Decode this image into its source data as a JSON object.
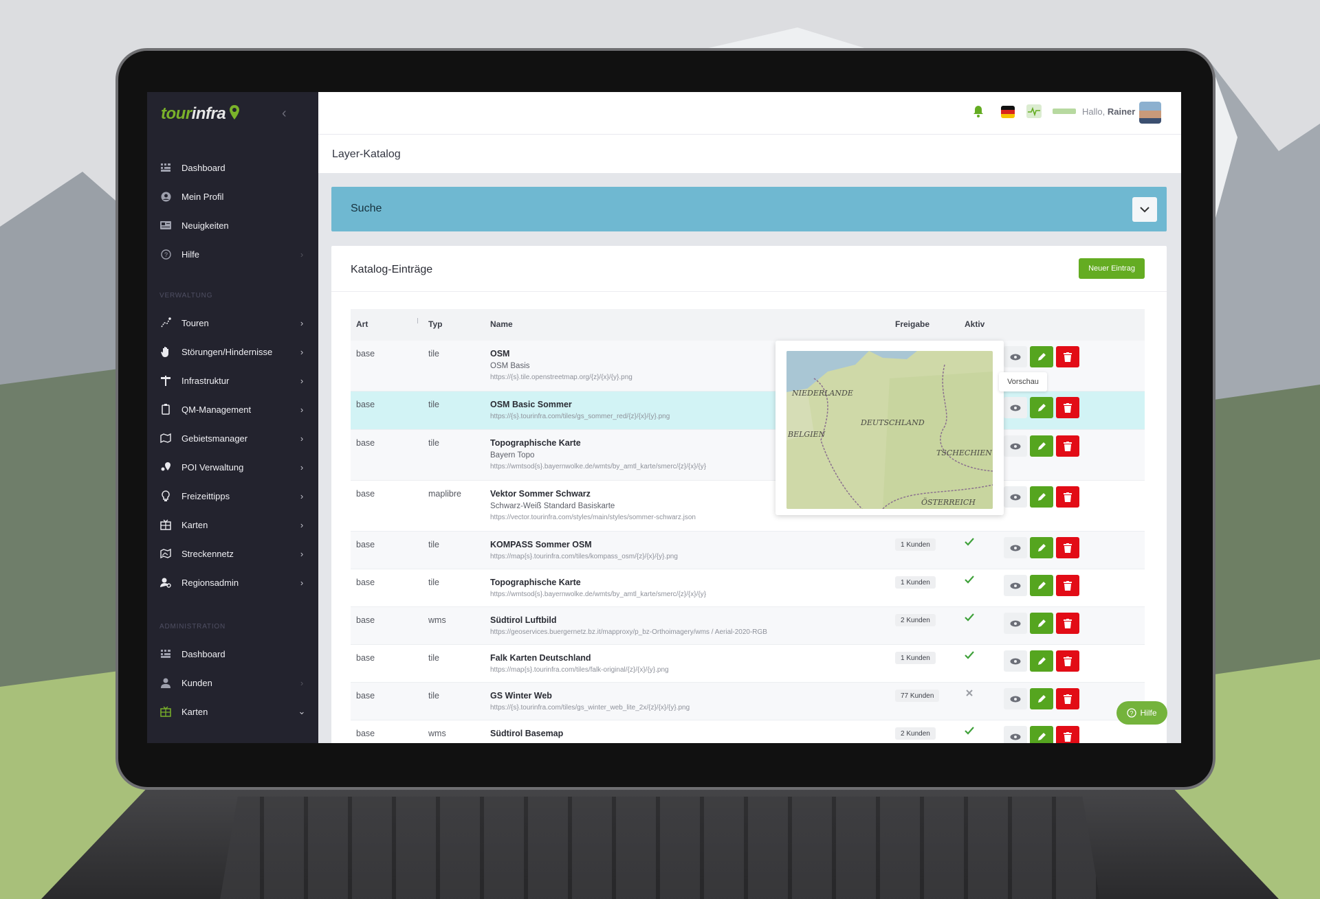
{
  "app": {
    "logo_part1": "tour",
    "logo_part2": "infra"
  },
  "sidebar": {
    "items": [
      {
        "label": "Dashboard",
        "icon": "grid-icon",
        "chevron": false
      },
      {
        "label": "Mein Profil",
        "icon": "user-circle-icon",
        "chevron": false
      },
      {
        "label": "Neuigkeiten",
        "icon": "newspaper-icon",
        "chevron": false
      },
      {
        "label": "Hilfe",
        "icon": "question-circle-icon",
        "chevron": true
      },
      {
        "label": "Touren",
        "icon": "route-icon",
        "chevron": true
      },
      {
        "label": "Störungen/Hindernisse",
        "icon": "hand-icon",
        "chevron": true
      },
      {
        "label": "Infrastruktur",
        "icon": "signpost-icon",
        "chevron": true
      },
      {
        "label": "QM-Management",
        "icon": "clipboard-icon",
        "chevron": true
      },
      {
        "label": "Gebietsmanager",
        "icon": "map-icon",
        "chevron": true
      },
      {
        "label": "POI Verwaltung",
        "icon": "map-pin-icon",
        "chevron": true
      },
      {
        "label": "Freizeittipps",
        "icon": "lightbulb-icon",
        "chevron": true
      },
      {
        "label": "Karten",
        "icon": "map-grid-icon",
        "chevron": true
      },
      {
        "label": "Streckennetz",
        "icon": "network-icon",
        "chevron": true
      },
      {
        "label": "Regionsadmin",
        "icon": "users-cog-icon",
        "chevron": true
      },
      {
        "label": "Dashboard",
        "icon": "grid-icon",
        "chevron": false
      },
      {
        "label": "Kunden",
        "icon": "user-icon",
        "chevron": true
      },
      {
        "label": "Karten",
        "icon": "map-grid-icon",
        "chevron": "down"
      }
    ],
    "section_verwaltung": "VERWALTUNG",
    "section_administration": "ADMINISTRATION"
  },
  "topbar": {
    "greeting": "Hallo,",
    "user": "Rainer",
    "brand_color": "#7ab22a"
  },
  "page": {
    "title": "Layer-Katalog"
  },
  "search": {
    "label": "Suche"
  },
  "catalog": {
    "title": "Katalog-Einträge",
    "new_button": "Neuer Eintrag",
    "columns": {
      "art": "Art",
      "typ": "Typ",
      "name": "Name",
      "freigabe": "Freigabe",
      "aktiv": "Aktiv"
    },
    "rows": [
      {
        "art": "base",
        "typ": "tile",
        "name": "OSM",
        "desc": "OSM Basis",
        "url": "https://{s}.tile.openstreetmap.org/{z}/{x}/{y}.png",
        "freigabe": "",
        "aktiv": ""
      },
      {
        "art": "base",
        "typ": "tile",
        "name": "OSM Basic Sommer",
        "desc": "",
        "url": "https://{s}.tourinfra.com/tiles/gs_sommer_red/{z}/{x}/{y}.png",
        "freigabe": "",
        "aktiv": ""
      },
      {
        "art": "base",
        "typ": "tile",
        "name": "Topographische Karte",
        "desc": "Bayern Topo",
        "url": "https://wmtsod{s}.bayernwolke.de/wmts/by_amtl_karte/smerc/{z}/{x}/{y}",
        "freigabe": "",
        "aktiv": ""
      },
      {
        "art": "base",
        "typ": "maplibre",
        "name": "Vektor Sommer Schwarz",
        "desc": "Schwarz-Weiß Standard Basiskarte",
        "url": "https://vector.tourinfra.com/styles/main/styles/sommer-schwarz.json",
        "freigabe": "",
        "aktiv": ""
      },
      {
        "art": "base",
        "typ": "tile",
        "name": "KOMPASS Sommer OSM",
        "desc": "",
        "url": "https://map{s}.tourinfra.com/tiles/kompass_osm/{z}/{x}/{y}.png",
        "freigabe": "1 Kunden",
        "aktiv": "yes"
      },
      {
        "art": "base",
        "typ": "tile",
        "name": "Topographische Karte",
        "desc": "",
        "url": "https://wmtsod{s}.bayernwolke.de/wmts/by_amtl_karte/smerc/{z}/{x}/{y}",
        "freigabe": "1 Kunden",
        "aktiv": "yes"
      },
      {
        "art": "base",
        "typ": "wms",
        "name": "Südtirol Luftbild",
        "desc": "",
        "url": "https://geoservices.buergernetz.bz.it/mapproxy/p_bz-Orthoimagery/wms / Aerial-2020-RGB",
        "freigabe": "2 Kunden",
        "aktiv": "yes"
      },
      {
        "art": "base",
        "typ": "tile",
        "name": "Falk Karten Deutschland",
        "desc": "",
        "url": "https://map{s}.tourinfra.com/tiles/falk-original/{z}/{x}/{y}.png",
        "freigabe": "1 Kunden",
        "aktiv": "yes"
      },
      {
        "art": "base",
        "typ": "tile",
        "name": "GS Winter Web",
        "desc": "",
        "url": "https://{s}.tourinfra.com/tiles/gs_winter_web_lite_2x/{z}/{x}/{y}.png",
        "freigabe": "77 Kunden",
        "aktiv": "no"
      },
      {
        "art": "base",
        "typ": "wms",
        "name": "Südtirol Basemap",
        "desc": "",
        "url": "",
        "freigabe": "2 Kunden",
        "aktiv": "yes"
      }
    ]
  },
  "preview": {
    "tooltip": "Vorschau",
    "map_labels": {
      "nl": "NIEDERLANDE",
      "de": "DEUTSCHLAND",
      "be": "BELGIEN",
      "cz": "TSCHECHIEN",
      "at": "ÖSTERREICH"
    }
  },
  "help_button": {
    "label": "Hilfe"
  },
  "colors": {
    "green": "#64ac22",
    "red": "#e20c16",
    "search_bar": "#6fb8d1",
    "sidebar": "#23232e",
    "highlight_row": "#d2f3f5"
  }
}
